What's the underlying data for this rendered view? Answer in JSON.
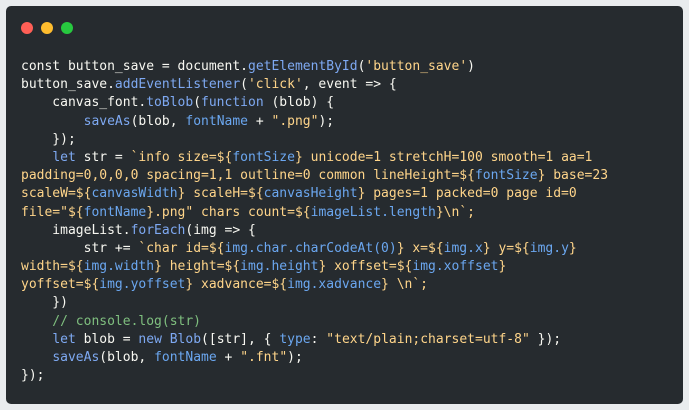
{
  "colors": {
    "background": "#262b2f",
    "page": "#e9ecee",
    "dot_close": "#ff5f56",
    "dot_minimize": "#ffbd2e",
    "dot_maximize": "#27c93f"
  },
  "code_lines": [
    [
      {
        "t": "const button_save = ",
        "c": "plain"
      },
      {
        "t": "document",
        "c": "plain"
      },
      {
        "t": ".",
        "c": "plain"
      },
      {
        "t": "getElementById",
        "c": "method"
      },
      {
        "t": "(",
        "c": "plain"
      },
      {
        "t": "'button_save'",
        "c": "str"
      },
      {
        "t": ")",
        "c": "plain"
      }
    ],
    [
      {
        "t": "button_save.",
        "c": "plain"
      },
      {
        "t": "addEventListener",
        "c": "method"
      },
      {
        "t": "(",
        "c": "plain"
      },
      {
        "t": "'click'",
        "c": "str"
      },
      {
        "t": ", event => {",
        "c": "plain"
      }
    ],
    [
      {
        "t": "    canvas_font.",
        "c": "plain"
      },
      {
        "t": "toBlob",
        "c": "method"
      },
      {
        "t": "(",
        "c": "plain"
      },
      {
        "t": "function",
        "c": "kw"
      },
      {
        "t": " (blob) {",
        "c": "plain"
      }
    ],
    [
      {
        "t": "        ",
        "c": "plain"
      },
      {
        "t": "saveAs",
        "c": "method"
      },
      {
        "t": "(blob, ",
        "c": "plain"
      },
      {
        "t": "fontName",
        "c": "interp"
      },
      {
        "t": " + ",
        "c": "plain"
      },
      {
        "t": "\".png\"",
        "c": "str"
      },
      {
        "t": ");",
        "c": "plain"
      }
    ],
    [
      {
        "t": "    });",
        "c": "plain"
      }
    ],
    [
      {
        "t": "    ",
        "c": "plain"
      },
      {
        "t": "let",
        "c": "kw"
      },
      {
        "t": " str = ",
        "c": "plain"
      },
      {
        "t": "`info size=${",
        "c": "str"
      },
      {
        "t": "fontSize",
        "c": "interp"
      },
      {
        "t": "} unicode=1 stretchH=100 smooth=1 aa=1",
        "c": "str"
      }
    ],
    [
      {
        "t": "padding=0,0,0,0 spacing=1,1 outline=0 common lineHeight=${",
        "c": "str"
      },
      {
        "t": "fontSize",
        "c": "interp"
      },
      {
        "t": "} base=23",
        "c": "str"
      }
    ],
    [
      {
        "t": "scaleW=${",
        "c": "str"
      },
      {
        "t": "canvasWidth",
        "c": "interp"
      },
      {
        "t": "} scaleH=${",
        "c": "str"
      },
      {
        "t": "canvasHeight",
        "c": "interp"
      },
      {
        "t": "} pages=1 packed=0 page id=0",
        "c": "str"
      }
    ],
    [
      {
        "t": "file=\"${",
        "c": "str"
      },
      {
        "t": "fontName",
        "c": "interp"
      },
      {
        "t": "}.png\" chars count=${",
        "c": "str"
      },
      {
        "t": "imageList.length",
        "c": "interp"
      },
      {
        "t": "}\\n`;",
        "c": "str"
      }
    ],
    [
      {
        "t": "    imageList.",
        "c": "plain"
      },
      {
        "t": "forEach",
        "c": "method"
      },
      {
        "t": "(img => {",
        "c": "plain"
      }
    ],
    [
      {
        "t": "        str += ",
        "c": "plain"
      },
      {
        "t": "`char id=${",
        "c": "str"
      },
      {
        "t": "img.char.charCodeAt(0)",
        "c": "interp"
      },
      {
        "t": "} x=${",
        "c": "str"
      },
      {
        "t": "img.x",
        "c": "interp"
      },
      {
        "t": "} y=${",
        "c": "str"
      },
      {
        "t": "img.y",
        "c": "interp"
      },
      {
        "t": "}",
        "c": "str"
      }
    ],
    [
      {
        "t": "width=${",
        "c": "str"
      },
      {
        "t": "img.width",
        "c": "interp"
      },
      {
        "t": "} height=${",
        "c": "str"
      },
      {
        "t": "img.height",
        "c": "interp"
      },
      {
        "t": "} xoffset=${",
        "c": "str"
      },
      {
        "t": "img.xoffset",
        "c": "interp"
      },
      {
        "t": "}",
        "c": "str"
      }
    ],
    [
      {
        "t": "yoffset=${",
        "c": "str"
      },
      {
        "t": "img.yoffset",
        "c": "interp"
      },
      {
        "t": "} xadvance=${",
        "c": "str"
      },
      {
        "t": "img.xadvance",
        "c": "interp"
      },
      {
        "t": "} \\n`;",
        "c": "str"
      }
    ],
    [
      {
        "t": "    })",
        "c": "plain"
      }
    ],
    [
      {
        "t": "    // console.log(str)",
        "c": "comment"
      }
    ],
    [
      {
        "t": "    ",
        "c": "plain"
      },
      {
        "t": "let",
        "c": "kw"
      },
      {
        "t": " blob = ",
        "c": "plain"
      },
      {
        "t": "new",
        "c": "kw"
      },
      {
        "t": " ",
        "c": "plain"
      },
      {
        "t": "Blob",
        "c": "method"
      },
      {
        "t": "([str], { ",
        "c": "plain"
      },
      {
        "t": "type",
        "c": "interp"
      },
      {
        "t": ": ",
        "c": "plain"
      },
      {
        "t": "\"text/plain;charset=utf-8\"",
        "c": "str"
      },
      {
        "t": " });",
        "c": "plain"
      }
    ],
    [
      {
        "t": "    ",
        "c": "plain"
      },
      {
        "t": "saveAs",
        "c": "method"
      },
      {
        "t": "(blob, ",
        "c": "plain"
      },
      {
        "t": "fontName",
        "c": "interp"
      },
      {
        "t": " + ",
        "c": "plain"
      },
      {
        "t": "\".fnt\"",
        "c": "str"
      },
      {
        "t": ");",
        "c": "plain"
      }
    ],
    [
      {
        "t": "});",
        "c": "plain"
      }
    ]
  ]
}
